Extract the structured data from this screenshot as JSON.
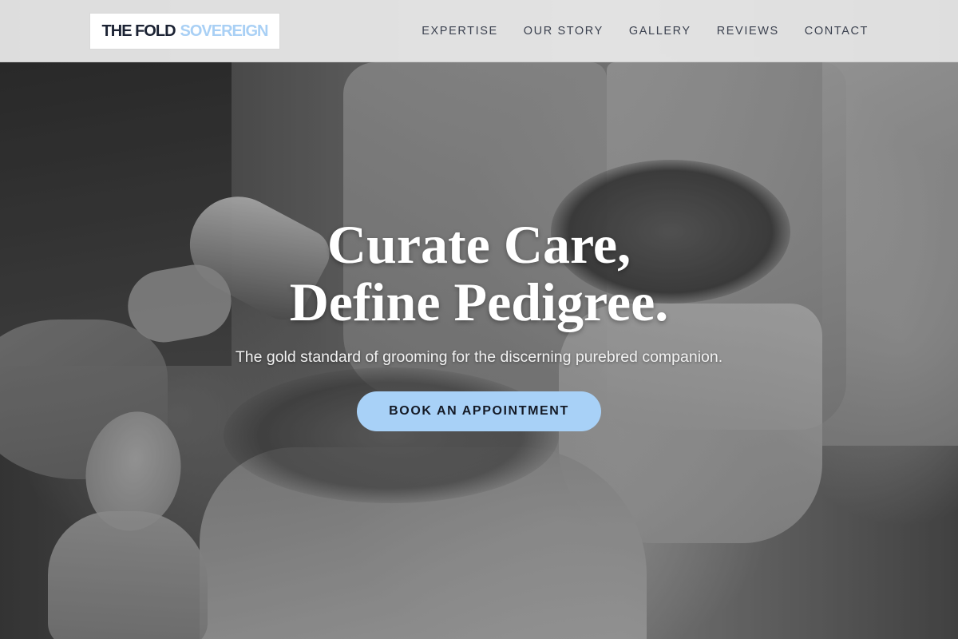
{
  "brand": {
    "name_dark": "THE FOLD",
    "name_light": "SOVEREIGN"
  },
  "nav": {
    "items": [
      {
        "label": "EXPERTISE"
      },
      {
        "label": "OUR STORY"
      },
      {
        "label": "GALLERY"
      },
      {
        "label": "REVIEWS"
      },
      {
        "label": "CONTACT"
      }
    ]
  },
  "hero": {
    "headline_line1": "Curate Care,",
    "headline_line2": "Define Pedigree.",
    "subheadline": "The gold standard of grooming for the discerning purebred companion.",
    "cta_label": "BOOK AN APPOINTMENT",
    "background_image": "grayscale photo of a long-haired dog being blow-dried and brushed"
  },
  "colors": {
    "accent": "#a8d1f7",
    "brand_dark": "#1b2233",
    "brand_light": "#a9d0f5",
    "nav_text": "#3c4250"
  }
}
